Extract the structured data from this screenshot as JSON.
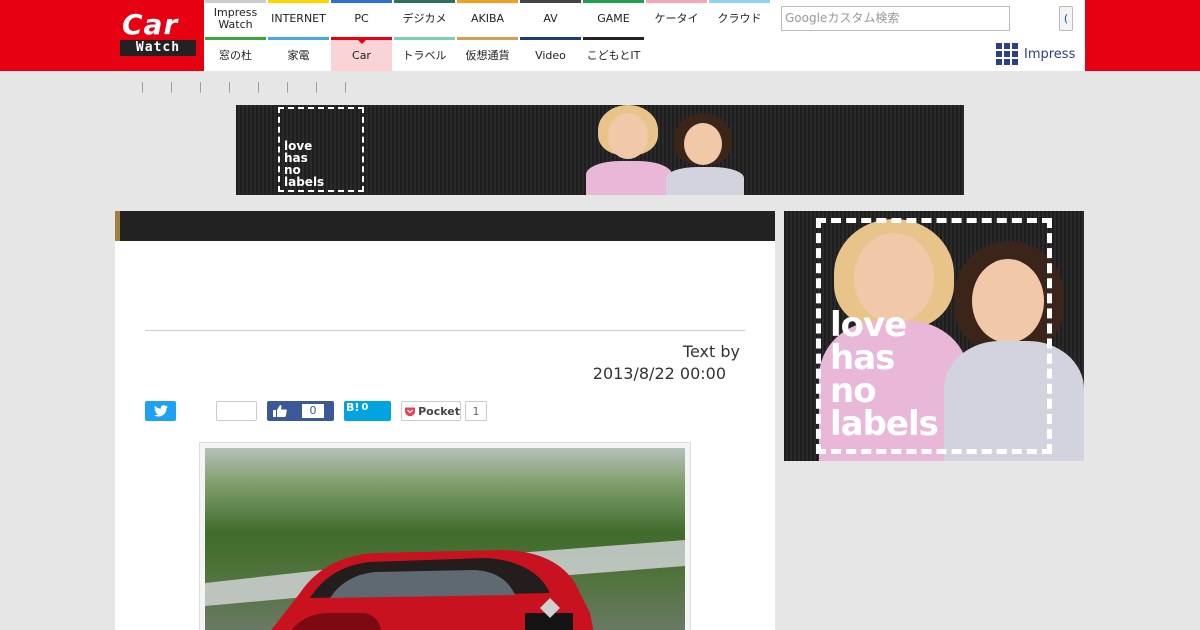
{
  "logo": {
    "line1": "Car",
    "line2": "Watch"
  },
  "nav": {
    "top": [
      "Impress\nWatch",
      "INTERNET",
      "PC",
      "デジカメ",
      "AKIBA",
      "AV",
      "GAME",
      "ケータイ",
      "クラウド"
    ],
    "bottom": [
      "窓の杜",
      "家電",
      "Car",
      "トラベル",
      "仮想通貨",
      "Video",
      "こどもとIT"
    ],
    "active": "Car",
    "top_colors": [
      "#cccccc",
      "#ffd400",
      "#2f6fd6",
      "#2f6f5f",
      "#f0a020",
      "#444444",
      "#21a053",
      "#f4a6b8",
      "#8fd3f0"
    ],
    "bottom_colors": [
      "#3aa63a",
      "#4aa8e0",
      "#e60012",
      "#7bd1b0",
      "#d0a050",
      "#1a3c7a",
      "#222222"
    ]
  },
  "search": {
    "placeholder": "Googleカスタム検索",
    "button_label": "("
  },
  "impress": {
    "label": "Impress"
  },
  "breadcrumb": {
    "separators": [
      "|",
      "|",
      "|",
      "|",
      "|",
      "|",
      "|",
      "|"
    ]
  },
  "banner_top": {
    "text": "love\nhas\nno\nlabels"
  },
  "banner_side": {
    "text": "love\nhas\nno\nlabels"
  },
  "article": {
    "author": "Text by",
    "date": "2013/8/22 00:00"
  },
  "share": {
    "facebook_count": "0",
    "hatena_label": "B!",
    "hatena_count": "0",
    "pocket_label": "Pocket",
    "pocket_count": "1"
  },
  "colors": {
    "brand": "#e60012",
    "title_bar": "#222222"
  }
}
